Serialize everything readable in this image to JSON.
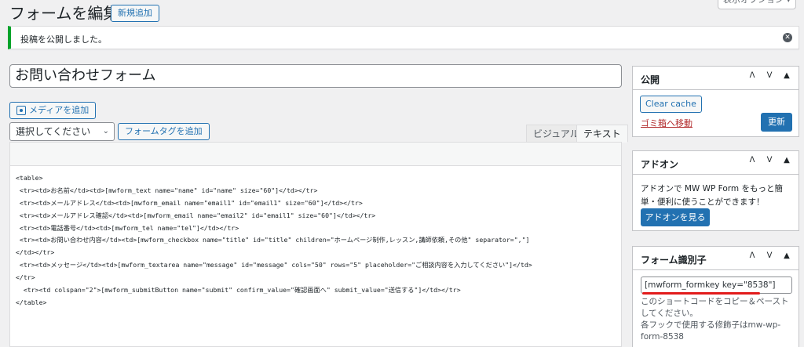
{
  "header": {
    "title": "フォームを編集",
    "add_new_label": "新規追加",
    "screen_options_label": "表示オプション ▾"
  },
  "notice": {
    "text": "投稿を公開しました。",
    "dismiss_symbol": "✕"
  },
  "post_title": "お問い合わせフォーム",
  "editor": {
    "add_media_label": "メディアを追加",
    "select_value": "選択してください",
    "select_chevron": "⌄",
    "form_tag_label": "フォームタグを追加",
    "tab_visual": "ビジュアル",
    "tab_text": "テキスト",
    "content_lines": [
      "<table>",
      " <tr><td>お名前</td><td>[mwform_text name=\"name\" id=\"name\" size=\"60\"]</td></tr>",
      " <tr><td>メールアドレス</td><td>[mwform_email name=\"email1\" id=\"email1\" size=\"60\"]</td></tr>",
      " <tr><td>メールアドレス確認</td><td>[mwform_email name=\"email2\" id=\"email1\" size=\"60\"]</td></tr>",
      " <tr><td>電話番号</td><td>[mwform_tel name=\"tel\"]</td></tr>",
      " <tr><td>お問い合わせ内容</td><td>[mwform_checkbox name=\"title\" id=\"title\" children=\"ホームページ制作,レッスン,講師依頼,その他\" separator=\",\"]",
      "</td></tr>",
      " <tr><td>メッセージ</td><td>[mwform_textarea name=\"message\" id=\"message\" cols=\"50\" rows=\"5\" placeholder=\"ご相談内容を入力してください\"]</td>",
      "</tr>",
      "  <tr><td colspan=\"2\">[mwform_submitButton name=\"submit\" confirm_value=\"確認画面へ\" submit_value=\"送信する\"]</td></tr>",
      "</table>"
    ]
  },
  "sidebar": {
    "ctrl_up": "ᐱ",
    "ctrl_down": "ᐯ",
    "ctrl_toggle": "▲",
    "publish": {
      "title": "公開",
      "clear_cache_label": "Clear cache",
      "trash_label": "ゴミ箱へ移動",
      "update_label": "更新"
    },
    "addon": {
      "title": "アドオン",
      "text": "アドオンで MW WP Form をもっと簡単・便利に使うことができます！",
      "button_label": "アドオンを見る"
    },
    "form_key": {
      "title": "フォーム識別子",
      "shortcode": "[mwform_formkey key=\"8538\"]",
      "description": "このショートコードをコピー＆ペーストしてください。",
      "hook_hint": "各フックで使用する修飾子はmw-wp-form-8538"
    }
  },
  "colors": {
    "accent": "#2271b1",
    "notice_border": "#00a32a",
    "trash": "#b32d2e",
    "highlight_underline": "#e21b1b"
  }
}
